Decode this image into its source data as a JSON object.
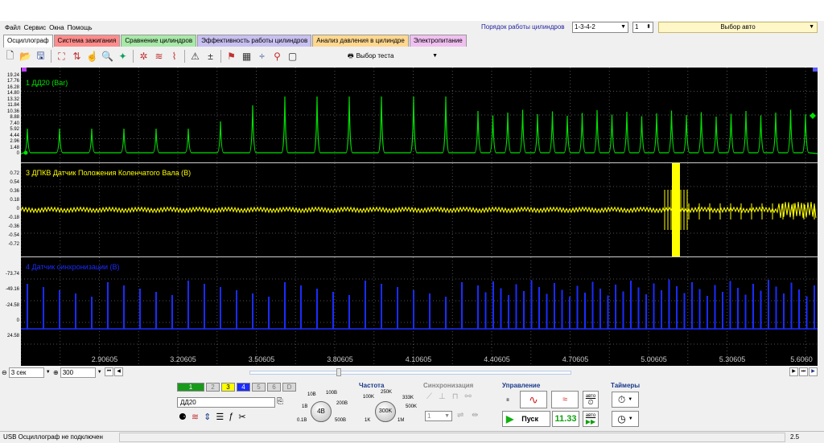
{
  "menu": [
    "Файл",
    "Сервис",
    "Окна",
    "Помощь"
  ],
  "cylinder_order": {
    "label": "Порядок работы цилиндров",
    "value": "1-3-4-2",
    "cyl": "1"
  },
  "auto_select": "Выбор авто",
  "tabs": [
    {
      "label": "Осциллограф",
      "color": "#ffffff"
    },
    {
      "label": "Система зажигания",
      "color": "#ff8c8c"
    },
    {
      "label": "Сравнение цилиндров",
      "color": "#a8e8a8"
    },
    {
      "label": "Эффективность работы цилиндров",
      "color": "#c8c0f0"
    },
    {
      "label": "Анализ давления в цилиндре",
      "color": "#ffd890"
    },
    {
      "label": "Электропитание",
      "color": "#f0c0f0"
    }
  ],
  "test_select": "Выбор теста",
  "channels": [
    {
      "label": "1 ДД20 (Bar)",
      "color": "#00e000",
      "yticks": [
        "19.24",
        "17.76",
        "16.28",
        "14.80",
        "13.32",
        "11.84",
        "10.36",
        "8.88",
        "7.40",
        "5.92",
        "4.44",
        "2.96",
        "1.48",
        "0"
      ]
    },
    {
      "label": "3 ДПКВ Датчик Положения Коленчатого Вала (B)",
      "color": "#ffff00",
      "yticks": [
        "0.72",
        "0.54",
        "0.36",
        "0.18",
        "0",
        "-0.18",
        "-0.36",
        "-0.54",
        "-0.72"
      ]
    },
    {
      "label": "4 Датчик синхронизации (B)",
      "color": "#1a2cff",
      "yticks": [
        "-73.74",
        "-49.16",
        "-24.58",
        "0",
        "24.58"
      ]
    }
  ],
  "x_ticks": [
    "2.90605",
    "3.20605",
    "3.50605",
    "3.80605",
    "4.10605",
    "4.40605",
    "4.70605",
    "5.00605",
    "5.30605",
    "5.6060"
  ],
  "timebase": "3 сек",
  "points": "300",
  "panel": {
    "channel_buttons": [
      "1",
      "2",
      "3",
      "4",
      "5",
      "6",
      "D"
    ],
    "channel_name": "ДД20",
    "volt_labels": [
      "10В",
      "100В",
      "1В",
      "200В",
      "0.1В",
      "500В"
    ],
    "volt_value": "4В",
    "freq_title": "Частота",
    "freq_labels": [
      "250K",
      "100K",
      "333K",
      "500K",
      "1K",
      "1M"
    ],
    "freq_value": "300K",
    "sync_title": "Синхронизация",
    "sync_channel": "1",
    "control_title": "Управление",
    "start_label": "Пуск",
    "value_display": "11.33",
    "auto_label": "авто",
    "timers_title": "Таймеры"
  },
  "status": {
    "usb": "USB Осциллограф не подключен",
    "right": "2.5"
  }
}
